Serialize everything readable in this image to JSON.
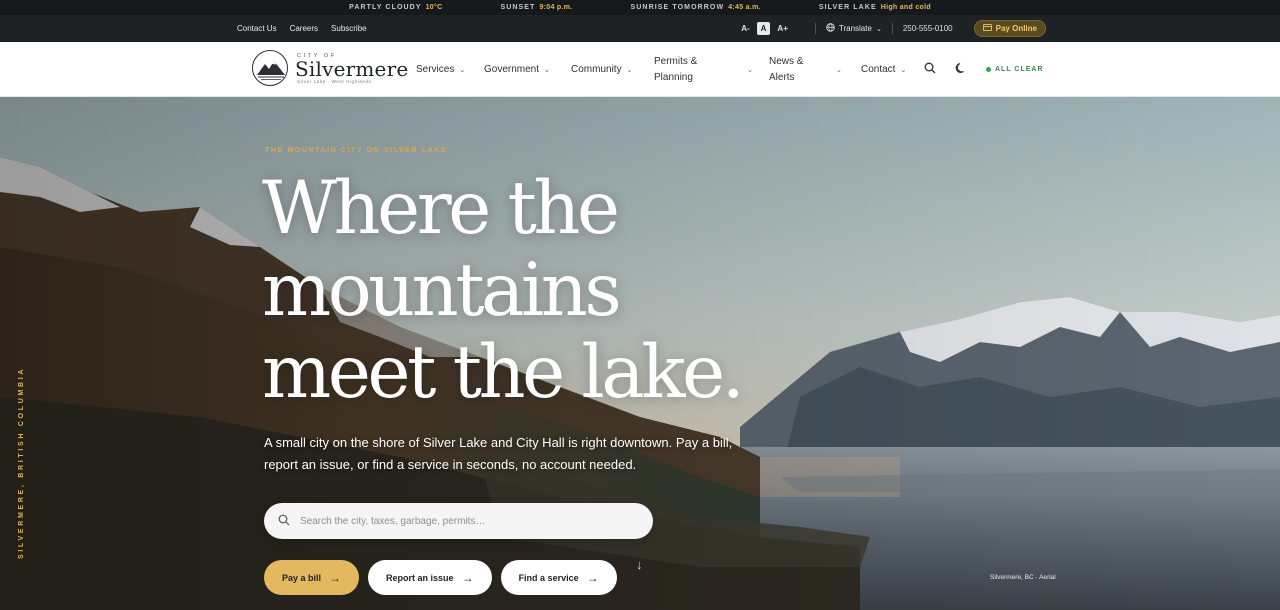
{
  "ticker": {
    "items": [
      {
        "key": "PARTLY CLOUDY",
        "value": "10°C"
      },
      {
        "key": "SUNSET",
        "value": "9:04 p.m."
      },
      {
        "key": "SUNRISE TOMORROW",
        "value": "4:45 a.m."
      },
      {
        "key": "SILVER LAKE",
        "value": "High and cold"
      }
    ]
  },
  "utility": {
    "links": [
      "Contact Us",
      "Careers",
      "Subscribe"
    ],
    "font_sizes": [
      "A-",
      "A",
      "A+"
    ],
    "translate_label": "Translate",
    "phone": "250-555-0100",
    "pay_label": "Pay Online"
  },
  "brand": {
    "city_of": "CITY OF",
    "name": "Silvermere",
    "sub": "Silver Lake · West Highlands"
  },
  "nav": {
    "items": [
      {
        "label": "Services"
      },
      {
        "label": "Government"
      },
      {
        "label": "Community"
      },
      {
        "label": "Permits & Planning"
      },
      {
        "label": "News & Alerts"
      },
      {
        "label": "Contact"
      }
    ],
    "status": "ALL CLEAR"
  },
  "hero": {
    "side_text": "SILVERMERE, BRITISH COLUMBIA",
    "eyebrow": "THE MOUNTAIN CITY ON SILVER LAKE",
    "headline_lines": [
      "Where the",
      "mountains",
      "meet the lake."
    ],
    "lede": "A small city on the shore of Silver Lake and City Hall is right downtown. Pay a bill, report an issue, or find a service in seconds, no account needed.",
    "search_placeholder": "Search the city, taxes, garbage, permits…",
    "buttons": [
      "Pay a bill",
      "Report an issue",
      "Find a service"
    ],
    "credit": "Silvermere, BC · Aerial"
  },
  "colors": {
    "accent": "#e3b85f",
    "status_green": "#3aa05a",
    "dark_bar": "#1e2225"
  },
  "icons": [
    "globe-icon",
    "card-icon",
    "search-icon",
    "moon-icon",
    "arrow-right-icon",
    "arrow-down-icon",
    "chevron-down-icon"
  ]
}
